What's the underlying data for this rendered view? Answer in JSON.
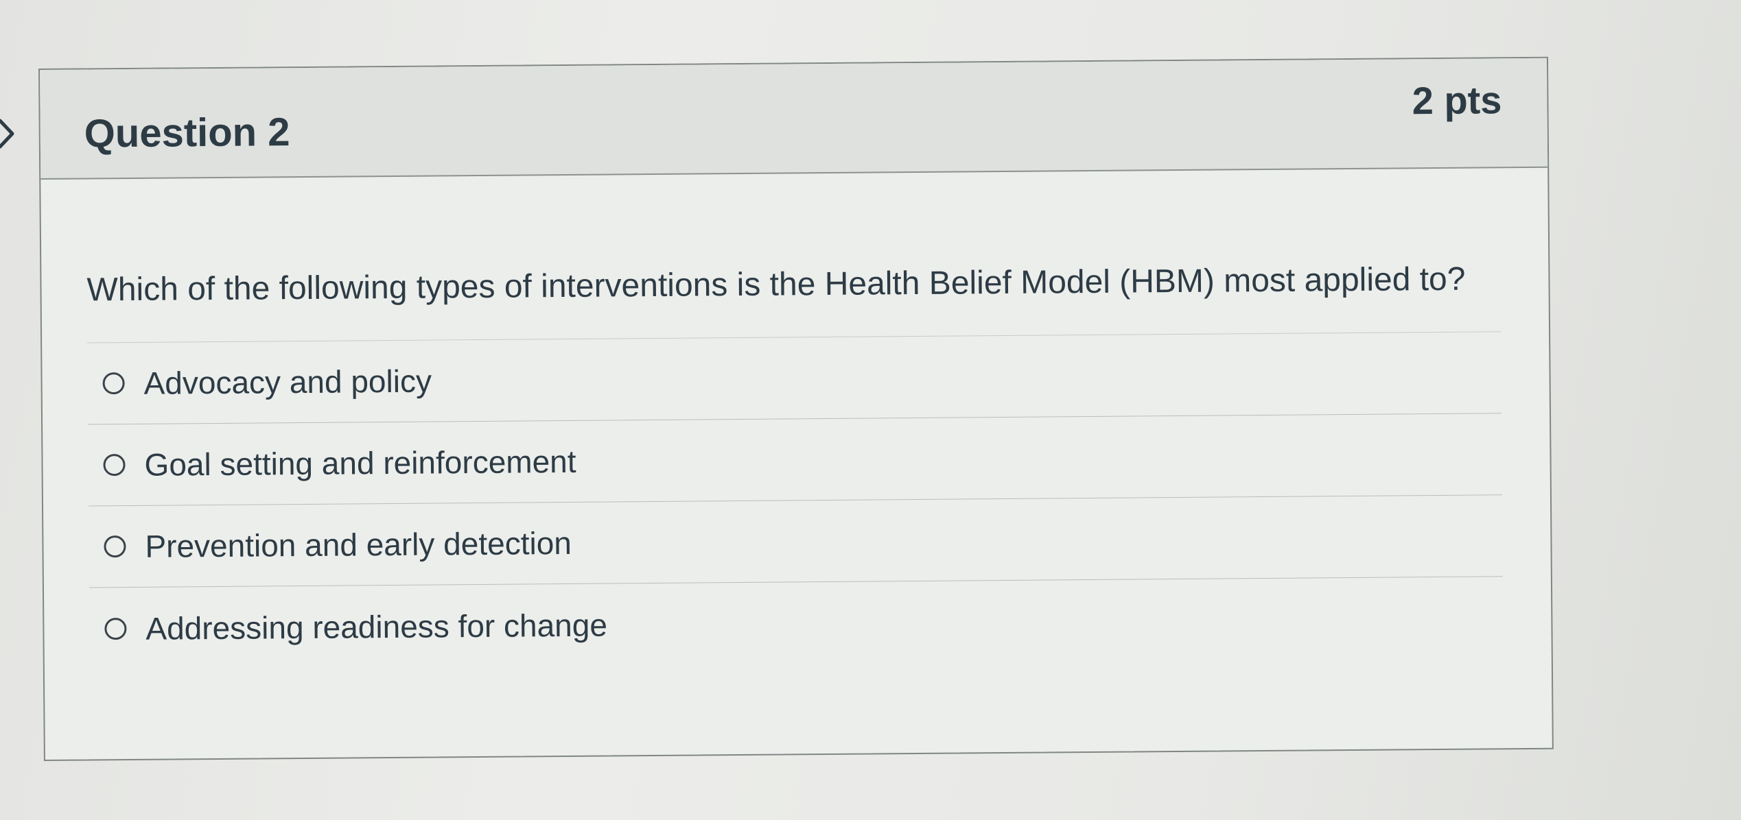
{
  "question": {
    "title": "Question 2",
    "points": "2 pts",
    "text": "Which of the following types of interventions is the Health Belief Model (HBM) most applied to?",
    "answers": [
      {
        "label": "Advocacy and policy",
        "selected": false
      },
      {
        "label": "Goal setting and reinforcement",
        "selected": false
      },
      {
        "label": "Prevention and early detection",
        "selected": false
      },
      {
        "label": "Addressing readiness for change",
        "selected": false
      }
    ]
  },
  "icons": {
    "nav": "chevron-right-icon",
    "answer_control": "radio-button-icon"
  },
  "colors": {
    "text": "#2d3b45",
    "header_bg": "#dfe1de",
    "card_bg": "#eceeeb",
    "border": "#7f8684"
  }
}
